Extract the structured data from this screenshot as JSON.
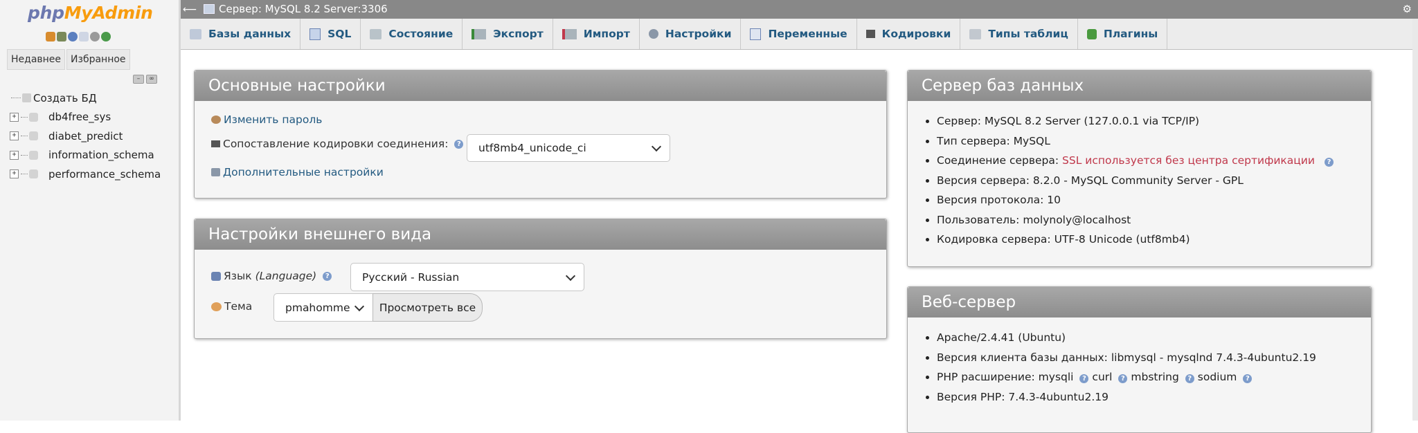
{
  "nav": {
    "logo_part1": "php",
    "logo_part2": "MyAdmin",
    "tabs": [
      "Недавнее",
      "Избранное"
    ],
    "tree": [
      {
        "label": "Создать БД"
      },
      {
        "label": "db4free_sys"
      },
      {
        "label": "diabet_predict"
      },
      {
        "label": "information_schema"
      },
      {
        "label": "performance_schema"
      }
    ]
  },
  "topbar": {
    "server": "Сервер: MySQL 8.2 Server:3306"
  },
  "tabs": [
    {
      "label": "Базы данных",
      "icon": "databases-icon"
    },
    {
      "label": "SQL",
      "icon": "sql-icon"
    },
    {
      "label": "Состояние",
      "icon": "status-icon"
    },
    {
      "label": "Экспорт",
      "icon": "export-icon"
    },
    {
      "label": "Импорт",
      "icon": "import-icon"
    },
    {
      "label": "Настройки",
      "icon": "settings-icon"
    },
    {
      "label": "Переменные",
      "icon": "variables-icon"
    },
    {
      "label": "Кодировки",
      "icon": "charset-icon"
    },
    {
      "label": "Типы таблиц",
      "icon": "engines-icon"
    },
    {
      "label": "Плагины",
      "icon": "plugins-icon"
    }
  ],
  "general": {
    "title": "Основные настройки",
    "change_password": "Изменить пароль",
    "collation_label": "Сопоставление кодировки соединения:",
    "collation_value": "utf8mb4_unicode_ci",
    "more_settings": "Дополнительные настройки"
  },
  "appearance": {
    "title": "Настройки внешнего вида",
    "language_label": "Язык",
    "language_label_en": "(Language)",
    "language_value": "Русский - Russian",
    "theme_label": "Тема",
    "theme_value": "pmahomme",
    "view_all": "Просмотреть все"
  },
  "db_server": {
    "title": "Сервер баз данных",
    "items": [
      {
        "label": "Сервер:",
        "value": "MySQL 8.2 Server (127.0.0.1 via TCP/IP)"
      },
      {
        "label": "Тип сервера:",
        "value": "MySQL"
      },
      {
        "label": "Соединение сервера:",
        "value": "SSL используется без центра сертификации"
      },
      {
        "label": "Версия сервера:",
        "value": "8.2.0 - MySQL Community Server - GPL"
      },
      {
        "label": "Версия протокола:",
        "value": "10"
      },
      {
        "label": "Пользователь:",
        "value": "molynoly@localhost"
      },
      {
        "label": "Кодировка сервера:",
        "value": "UTF-8 Unicode (utf8mb4)"
      }
    ]
  },
  "web_server": {
    "title": "Веб-сервер",
    "apache": "Apache/2.4.41 (Ubuntu)",
    "client_version": "Версия клиента базы данных: libmysql - mysqlnd 7.4.3-4ubuntu2.19",
    "php_ext_label": "PHP расширение:",
    "php_exts": [
      "mysqli",
      "curl",
      "mbstring",
      "sodium"
    ],
    "php_version": "Версия PHP: 7.4.3-4ubuntu2.19"
  },
  "colors": {
    "accent_link": "#235a81",
    "warning": "#c0384b",
    "panel_header": "#999999"
  }
}
